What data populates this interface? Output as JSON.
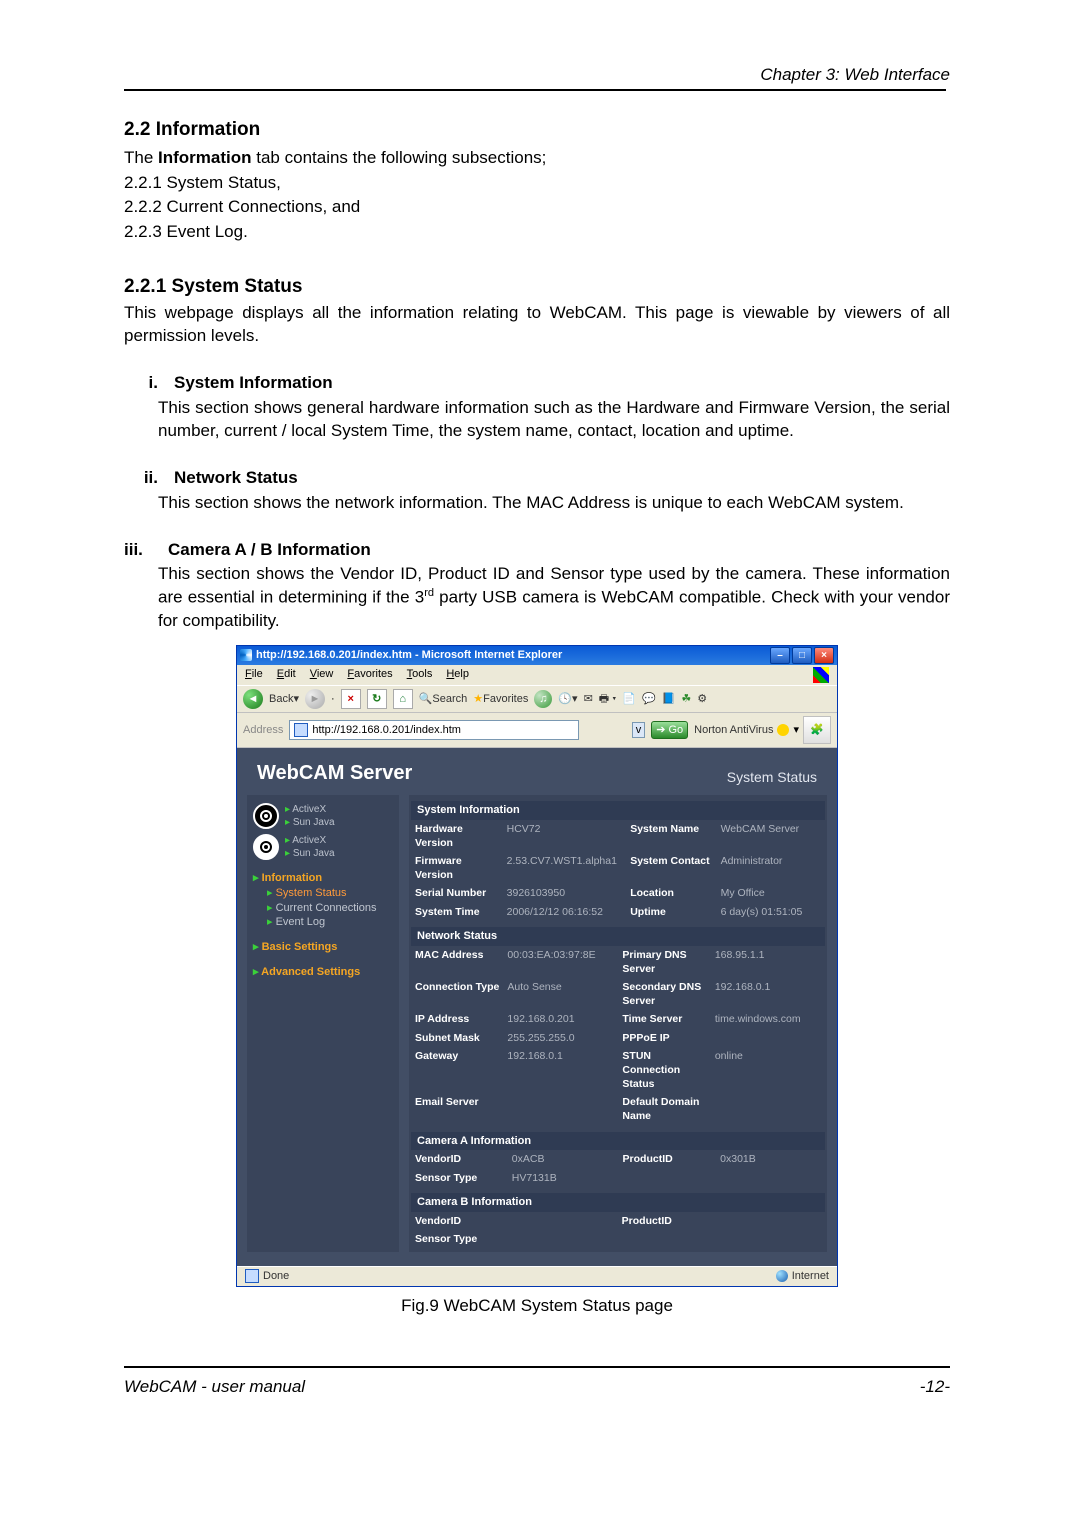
{
  "chapter": "Chapter 3: Web Interface",
  "section_heading": "2.2 Information",
  "intro": "The Information tab contains the following subsections;",
  "intro_bold": "Information",
  "list": [
    "2.2.1 System Status,",
    "2.2.2 Current Connections, and",
    "2.2.3 Event Log."
  ],
  "sub1": "2.2.1 System Status",
  "sub1_para": "This webpage displays all the information relating to WebCAM.  This page is viewable by viewers of all permission levels.",
  "i_num": "i.",
  "i_head": "System Information",
  "i_para": "This section shows general hardware information such as the Hardware and Firmware Version, the serial number, current / local System Time, the system name, contact, location and uptime.",
  "ii_num": "ii.",
  "ii_head": "Network Status",
  "ii_para": "This section shows the network information.  The MAC Address is unique to each WebCAM system.",
  "iii_num": "iii.",
  "iii_head": "Camera A / B Information",
  "iii_para_a": "This section shows the Vendor ID, Product ID and Sensor type used by the camera.  These information are essential in determining if the 3",
  "iii_para_b": " party USB camera is WebCAM compatible.  Check with your vendor for compatibility.",
  "sup_rd": "rd",
  "fig_caption": "Fig.9 WebCAM System Status page",
  "footer_left": "WebCAM - user manual",
  "footer_right": "-12-",
  "ie": {
    "title": "http://192.168.0.201/index.htm - Microsoft Internet Explorer",
    "menus": [
      "File",
      "Edit",
      "View",
      "Favorites",
      "Tools",
      "Help"
    ],
    "back": "Back",
    "search": "Search",
    "favorites": "Favorites",
    "addr_label": "Address",
    "addr_value": "http://192.168.0.201/index.htm",
    "go": "Go",
    "norton": "Norton AntiVirus",
    "status_done": "Done",
    "status_zone": "Internet"
  },
  "wc": {
    "title": "WebCAM Server",
    "subtitle": "System Status",
    "side": {
      "activex1": "ActiveX",
      "sunjava1": "Sun Java",
      "activex2": "ActiveX",
      "sunjava2": "Sun Java",
      "info": "Information",
      "info_items": [
        "System Status",
        "Current Connections",
        "Event Log"
      ],
      "basic": "Basic Settings",
      "adv": "Advanced Settings"
    },
    "sysinfo_head": "System Information",
    "sysinfo": {
      "hw_k": "Hardware Version",
      "hw_v": "HCV72",
      "fw_k": "Firmware Version",
      "fw_v": "2.53.CV7.WST1.alpha1",
      "sn_k": "Serial Number",
      "sn_v": "3926103950",
      "st_k": "System Time",
      "st_v": "2006/12/12 06:16:52",
      "name_k": "System Name",
      "name_v": "WebCAM Server",
      "contact_k": "System Contact",
      "contact_v": "Administrator",
      "loc_k": "Location",
      "loc_v": "My Office",
      "up_k": "Uptime",
      "up_v": "6 day(s) 01:51:05"
    },
    "net_head": "Network Status",
    "net": {
      "mac_k": "MAC Address",
      "mac_v": "00:03:EA:03:97:8E",
      "ct_k": "Connection Type",
      "ct_v": "Auto Sense",
      "ip_k": "IP Address",
      "ip_v": "192.168.0.201",
      "mask_k": "Subnet Mask",
      "mask_v": "255.255.255.0",
      "gw_k": "Gateway",
      "gw_v": "192.168.0.1",
      "mail_k": "Email Server",
      "mail_v": "",
      "dns1_k": "Primary DNS Server",
      "dns1_v": "168.95.1.1",
      "dns2_k": "Secondary DNS Server",
      "dns2_v": "192.168.0.1",
      "time_k": "Time Server",
      "time_v": "time.windows.com",
      "pppoe_k": "PPPoE IP",
      "pppoe_v": "",
      "stun_k": "STUN Connection Status",
      "stun_v": "online",
      "ddn_k": "Default Domain Name",
      "ddn_v": ""
    },
    "camA_head": "Camera A Information",
    "camA": {
      "vid_k": "VendorID",
      "vid_v": "0xACB",
      "pid_k": "ProductID",
      "pid_v": "0x301B",
      "sen_k": "Sensor Type",
      "sen_v": "HV7131B"
    },
    "camB_head": "Camera B Information",
    "camB": {
      "vid_k": "VendorID",
      "vid_v": "",
      "pid_k": "ProductID",
      "pid_v": "",
      "sen_k": "Sensor Type",
      "sen_v": ""
    }
  }
}
